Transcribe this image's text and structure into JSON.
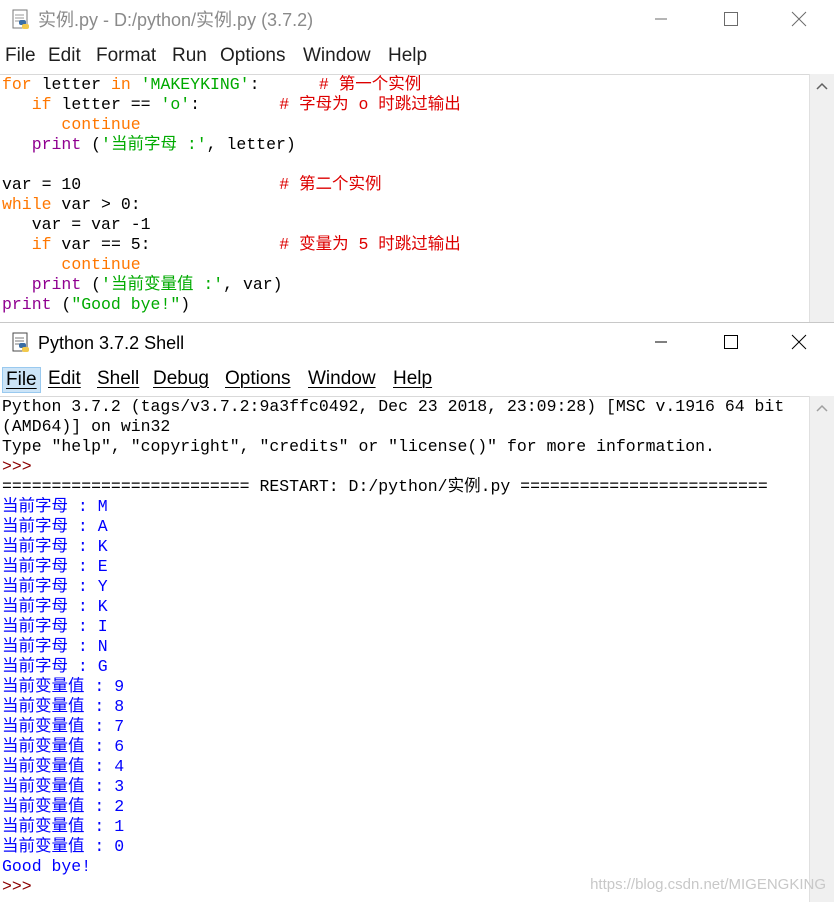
{
  "editor": {
    "title": "实例.py - D:/python/实例.py (3.7.2)",
    "menu": [
      "File",
      "Edit",
      "Format",
      "Run",
      "Options",
      "Window",
      "Help"
    ],
    "code": [
      {
        "p": "for",
        "t": "kw"
      },
      {
        "p": " letter ",
        "t": "pl"
      },
      {
        "p": "in",
        "t": "kw"
      },
      {
        "p": " ",
        "t": "pl"
      },
      {
        "p": "'MAKEYKING'",
        "t": "str"
      },
      {
        "p": ":",
        "t": "pl"
      },
      {
        "p": "      ",
        "t": "pl"
      },
      {
        "p": "# 第一个实例",
        "t": "cmt"
      }
    ],
    "lines": [
      [
        {
          "p": "for",
          "t": "kw"
        },
        {
          "p": " letter ",
          "t": "pl"
        },
        {
          "p": "in",
          "t": "kw"
        },
        {
          "p": " ",
          "t": "pl"
        },
        {
          "p": "'MAKEYKING'",
          "t": "str"
        },
        {
          "p": ":      ",
          "t": "pl"
        },
        {
          "p": "# 第一个实例",
          "t": "cmt"
        }
      ],
      [
        {
          "p": "   ",
          "t": "pl"
        },
        {
          "p": "if",
          "t": "kw"
        },
        {
          "p": " letter == ",
          "t": "pl"
        },
        {
          "p": "'o'",
          "t": "str"
        },
        {
          "p": ":        ",
          "t": "pl"
        },
        {
          "p": "# 字母为 o 时跳过输出",
          "t": "cmt"
        }
      ],
      [
        {
          "p": "      ",
          "t": "pl"
        },
        {
          "p": "continue",
          "t": "kw"
        }
      ],
      [
        {
          "p": "   ",
          "t": "pl"
        },
        {
          "p": "print",
          "t": "bi"
        },
        {
          "p": " (",
          "t": "pl"
        },
        {
          "p": "'当前字母 :'",
          "t": "str"
        },
        {
          "p": ", letter)",
          "t": "pl"
        }
      ],
      [],
      [
        {
          "p": "var = 10                    ",
          "t": "pl"
        },
        {
          "p": "# 第二个实例",
          "t": "cmt"
        }
      ],
      [
        {
          "p": "while",
          "t": "kw"
        },
        {
          "p": " var > 0:",
          "t": "pl"
        }
      ],
      [
        {
          "p": "   var = var -1",
          "t": "pl"
        }
      ],
      [
        {
          "p": "   ",
          "t": "pl"
        },
        {
          "p": "if",
          "t": "kw"
        },
        {
          "p": " var == 5:             ",
          "t": "pl"
        },
        {
          "p": "# 变量为 5 时跳过输出",
          "t": "cmt"
        }
      ],
      [
        {
          "p": "      ",
          "t": "pl"
        },
        {
          "p": "continue",
          "t": "kw"
        }
      ],
      [
        {
          "p": "   ",
          "t": "pl"
        },
        {
          "p": "print",
          "t": "bi"
        },
        {
          "p": " (",
          "t": "pl"
        },
        {
          "p": "'当前变量值 :'",
          "t": "str"
        },
        {
          "p": ", var)",
          "t": "pl"
        }
      ],
      [
        {
          "p": "print",
          "t": "bi"
        },
        {
          "p": " (",
          "t": "pl"
        },
        {
          "p": "\"Good bye!\"",
          "t": "str"
        },
        {
          "p": ")",
          "t": "pl"
        }
      ]
    ]
  },
  "shell": {
    "title": "Python 3.7.2 Shell",
    "menu": [
      "File",
      "Edit",
      "Shell",
      "Debug",
      "Options",
      "Window",
      "Help"
    ],
    "active_menu": "File",
    "lines": [
      [
        {
          "p": "Python 3.7.2 (tags/v3.7.2:9a3ffc0492, Dec 23 2018, 23:09:28) [MSC v.1916 64 bit",
          "t": "pl"
        }
      ],
      [
        {
          "p": "(AMD64)] on win32",
          "t": "pl"
        }
      ],
      [
        {
          "p": "Type \"help\", \"copyright\", \"credits\" or \"license()\" for more information.",
          "t": "pl"
        }
      ],
      [
        {
          "p": ">>> ",
          "t": "prompt"
        }
      ],
      [
        {
          "p": "========================= RESTART: D:/python/实例.py =========================",
          "t": "pl"
        }
      ],
      [
        {
          "p": "当前字母 : M",
          "t": "out"
        }
      ],
      [
        {
          "p": "当前字母 : A",
          "t": "out"
        }
      ],
      [
        {
          "p": "当前字母 : K",
          "t": "out"
        }
      ],
      [
        {
          "p": "当前字母 : E",
          "t": "out"
        }
      ],
      [
        {
          "p": "当前字母 : Y",
          "t": "out"
        }
      ],
      [
        {
          "p": "当前字母 : K",
          "t": "out"
        }
      ],
      [
        {
          "p": "当前字母 : I",
          "t": "out"
        }
      ],
      [
        {
          "p": "当前字母 : N",
          "t": "out"
        }
      ],
      [
        {
          "p": "当前字母 : G",
          "t": "out"
        }
      ],
      [
        {
          "p": "当前变量值 : 9",
          "t": "out"
        }
      ],
      [
        {
          "p": "当前变量值 : 8",
          "t": "out"
        }
      ],
      [
        {
          "p": "当前变量值 : 7",
          "t": "out"
        }
      ],
      [
        {
          "p": "当前变量值 : 6",
          "t": "out"
        }
      ],
      [
        {
          "p": "当前变量值 : 4",
          "t": "out"
        }
      ],
      [
        {
          "p": "当前变量值 : 3",
          "t": "out"
        }
      ],
      [
        {
          "p": "当前变量值 : 2",
          "t": "out"
        }
      ],
      [
        {
          "p": "当前变量值 : 1",
          "t": "out"
        }
      ],
      [
        {
          "p": "当前变量值 : 0",
          "t": "out"
        }
      ],
      [
        {
          "p": "Good bye!",
          "t": "out"
        }
      ],
      [
        {
          "p": ">>> ",
          "t": "prompt"
        }
      ]
    ]
  },
  "window_controls": {
    "minimize_icon": "minimize-icon",
    "maximize_icon": "maximize-icon",
    "close_icon": "close-icon"
  },
  "watermark": "https://blog.csdn.net/MIGENGKING",
  "colors": {
    "keyword": "#ff7700",
    "builtin": "#900090",
    "string": "#00aa00",
    "comment": "#dd0000",
    "stdout": "#0000ff",
    "prompt": "#8b0000"
  }
}
